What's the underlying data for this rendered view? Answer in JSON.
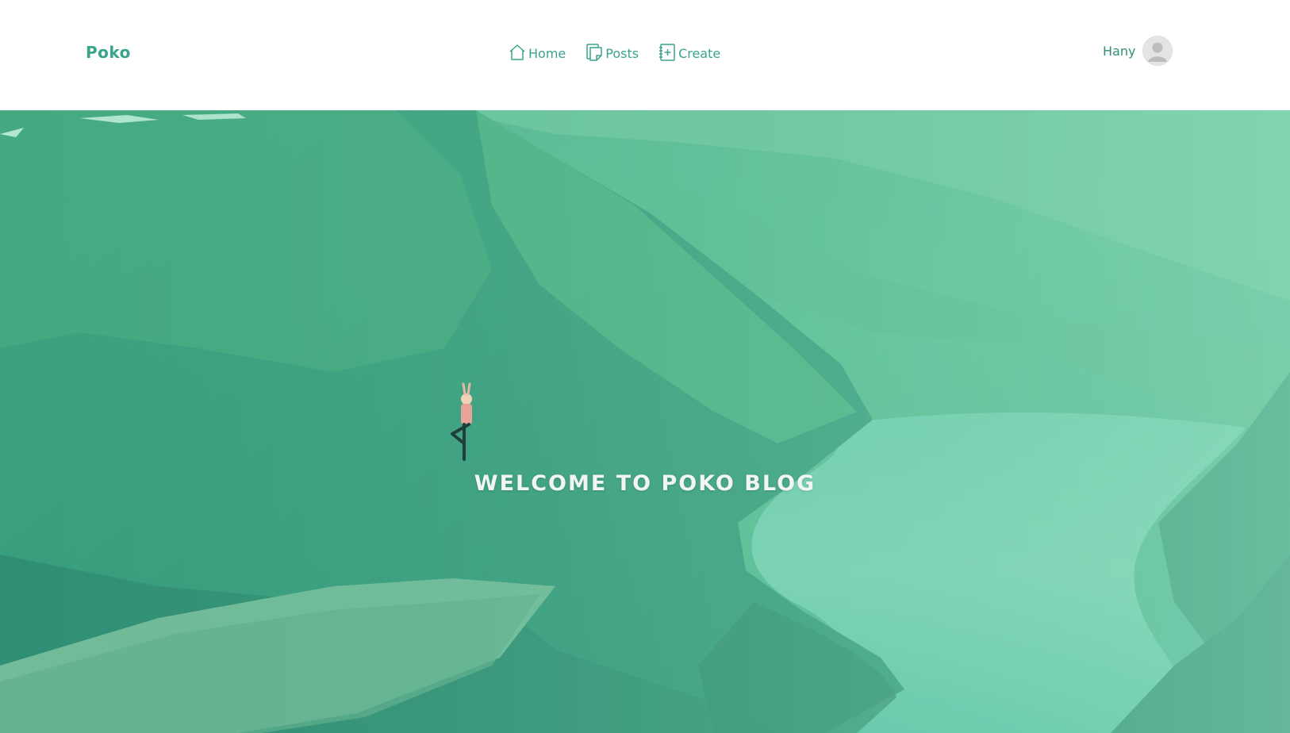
{
  "brand": {
    "name": "Poko"
  },
  "nav": {
    "items": [
      {
        "label": "Home",
        "icon": "home-icon"
      },
      {
        "label": "Posts",
        "icon": "posts-icon"
      },
      {
        "label": "Create",
        "icon": "create-icon"
      }
    ]
  },
  "user": {
    "name": "Hany",
    "avatar_icon": "user-avatar-icon"
  },
  "hero": {
    "title": "WELCOME TO POKO BLOG"
  },
  "colors": {
    "accent": "#3aa38c",
    "hero_overlay": "#3ec59b",
    "title": "#f1f5f3"
  }
}
